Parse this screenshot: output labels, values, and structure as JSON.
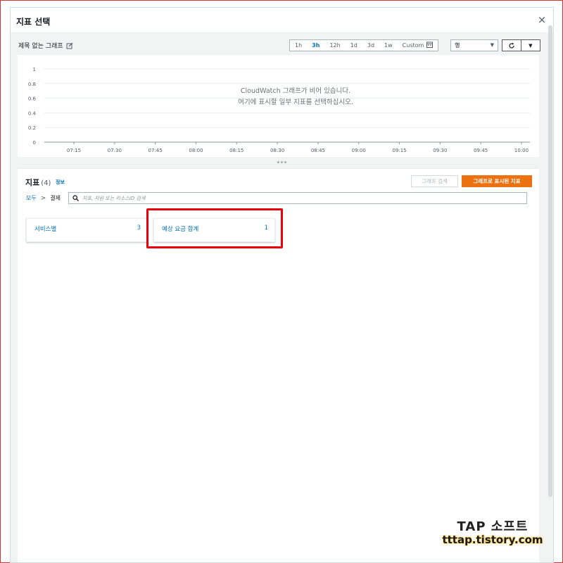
{
  "modal": {
    "title": "지표 선택",
    "close_label": "×"
  },
  "graph": {
    "title": "제목 없는 그래프",
    "time_ranges": [
      "1h",
      "3h",
      "12h",
      "1d",
      "3d",
      "1w",
      "Custom"
    ],
    "active_range": "3h",
    "chart_type": "행",
    "empty_message_line1": "CloudWatch 그래프가 비어 있습니다.",
    "empty_message_line2": "여기에 표시할 일부 지표를 선택하십시오."
  },
  "chart_data": {
    "type": "line",
    "x_ticks": [
      "07:15",
      "07:30",
      "07:45",
      "08:00",
      "08:15",
      "08:30",
      "08:45",
      "09:00",
      "09:15",
      "09:30",
      "09:45",
      "10:00"
    ],
    "y_ticks": [
      "1",
      "0.8",
      "0.6",
      "0.4",
      "0.2",
      "0"
    ],
    "ylim": [
      0,
      1
    ],
    "grid": true,
    "series": []
  },
  "metrics": {
    "heading": "지표",
    "count": "(4)",
    "info_label": "정보",
    "graph_search_label": "그래프 검색",
    "graphed_metrics_label": "그래프로 표시된 지표",
    "breadcrumb": {
      "all": "모두",
      "current": "결제"
    },
    "search_placeholder": "지표, 차원 또는 리소스ID 검색",
    "cards": [
      {
        "label": "서비스별",
        "count": "3"
      },
      {
        "label": "예상 요금 합계",
        "count": "1"
      }
    ]
  },
  "colors": {
    "accent": "#0073bb",
    "primary_button": "#ec7211",
    "highlight": "#e8000b"
  },
  "watermark": {
    "line1": "TAP 소프트",
    "line2": "tttap.tistory.com"
  }
}
